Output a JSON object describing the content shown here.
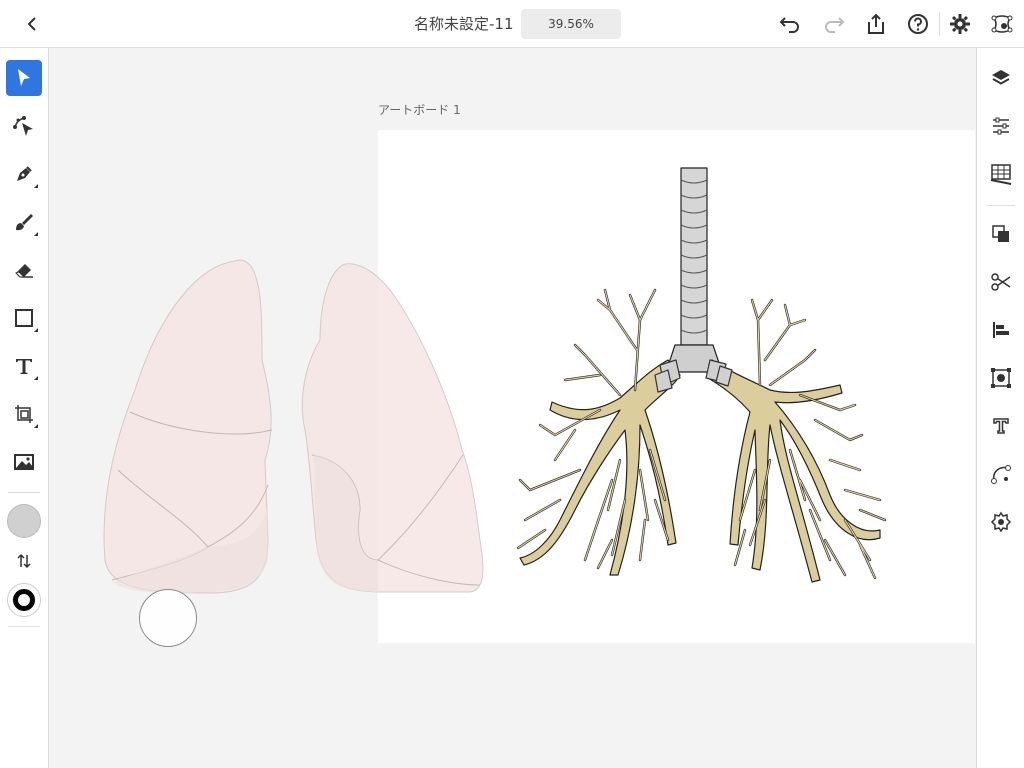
{
  "header": {
    "title": "名称未設定-11",
    "zoom": "39.56%"
  },
  "artboard": {
    "label": "アートボード 1"
  },
  "toolbar_left": {
    "tools": [
      {
        "name": "selection-tool",
        "icon": "arrow-cursor-icon"
      },
      {
        "name": "direct-selection-tool",
        "icon": "node-select-icon"
      },
      {
        "name": "pen-tool",
        "icon": "pen-nib-icon"
      },
      {
        "name": "brush-tool",
        "icon": "brush-icon"
      },
      {
        "name": "eraser-tool",
        "icon": "eraser-icon"
      },
      {
        "name": "shape-tool",
        "icon": "rectangle-icon"
      },
      {
        "name": "text-tool",
        "icon": "type-t-icon"
      },
      {
        "name": "transform-tool",
        "icon": "transform-icon"
      },
      {
        "name": "image-tool",
        "icon": "image-icon"
      }
    ],
    "fill_color": "#d0d0d0",
    "stroke_color": "#000000"
  },
  "toolbar_right": {
    "icons": [
      "layers-icon",
      "properties-sliders-icon",
      "grid-ruler-icon",
      "boolean-combine-icon",
      "scissors-icon",
      "align-icon",
      "repeat-grid-icon",
      "type-panel-icon",
      "path-icon",
      "settings-shape-icon"
    ]
  },
  "colors": {
    "accent": "#2f76e0",
    "lung_fill": "#f5e8e6",
    "bronchi_fill": "#dccd9c",
    "trachea_fill": "#d4d4d4"
  }
}
